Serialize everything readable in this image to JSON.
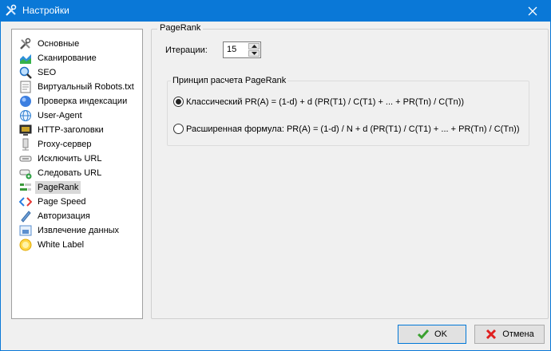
{
  "window": {
    "title": "Настройки"
  },
  "sidebar": {
    "items": [
      {
        "label": "Основные",
        "icon": "tools-icon"
      },
      {
        "label": "Сканирование",
        "icon": "scan-chart-icon"
      },
      {
        "label": "SEO",
        "icon": "magnifier-icon"
      },
      {
        "label": "Виртуальный Robots.txt",
        "icon": "robots-file-icon"
      },
      {
        "label": "Проверка индексации",
        "icon": "index-globe-icon"
      },
      {
        "label": "User-Agent",
        "icon": "globe-icon"
      },
      {
        "label": "HTTP-заголовки",
        "icon": "monitor-icon"
      },
      {
        "label": "Proxy-сервер",
        "icon": "proxy-icon"
      },
      {
        "label": "Исключить URL",
        "icon": "exclude-link-icon"
      },
      {
        "label": "Следовать URL",
        "icon": "follow-link-icon"
      },
      {
        "label": "PageRank",
        "icon": "pagerank-icon"
      },
      {
        "label": "Page Speed",
        "icon": "code-brackets-icon"
      },
      {
        "label": "Авторизация",
        "icon": "pen-icon"
      },
      {
        "label": "Извлечение данных",
        "icon": "extract-icon"
      },
      {
        "label": "White Label",
        "icon": "sun-badge-icon"
      }
    ],
    "selected": "PageRank"
  },
  "panel": {
    "legend": "PageRank",
    "iterations_label": "Итерации:",
    "iterations_value": "15",
    "group_legend": "Принцип расчета PageRank",
    "option_classic": "Классический PR(A) = (1-d) + d (PR(T1) / C(T1) + ... + PR(Tn) / C(Tn))",
    "option_extended": "Расширенная формула: PR(A) = (1-d) / N + d (PR(T1) / C(T1) + ... + PR(Tn) / C(Tn))",
    "selected_option": "classic"
  },
  "buttons": {
    "ok": "OK",
    "cancel": "Отмена"
  },
  "colors": {
    "titlebar": "#0a78d7",
    "ok_check": "#3aa02f",
    "cancel_x": "#e02020"
  }
}
